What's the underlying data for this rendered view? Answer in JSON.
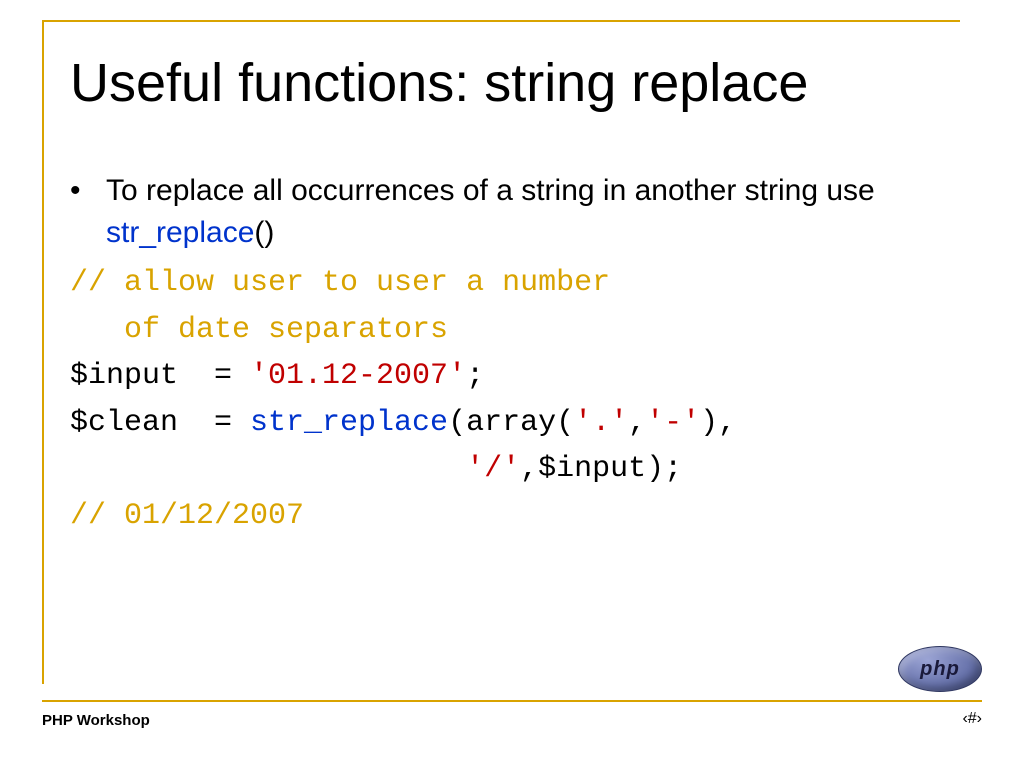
{
  "title": "Useful functions: string replace",
  "bullet": {
    "marker": "•",
    "text_before": "To replace all occurrences of a string in another string use ",
    "func": "str_replace",
    "text_after": "()"
  },
  "code": {
    "comment1a": "// allow user to user a number",
    "comment1b": "   of date separators",
    "l3_a": "$input  = ",
    "l3_b": "'01.12-2007'",
    "l3_c": ";",
    "l4_a": "$clean  = ",
    "l4_b": "str_replace",
    "l4_c": "(array(",
    "l4_d": "'.'",
    "l4_e": ",",
    "l4_f": "'-'",
    "l4_g": "),",
    "l5_a": "                      ",
    "l5_b": "'/'",
    "l5_c": ",$input);",
    "comment2": "// 01/12/2007"
  },
  "footer": {
    "left": "PHP Workshop",
    "right_prefix": "‹",
    "right_mid": "#",
    "right_suffix": "›"
  },
  "logo": {
    "text": "php"
  }
}
